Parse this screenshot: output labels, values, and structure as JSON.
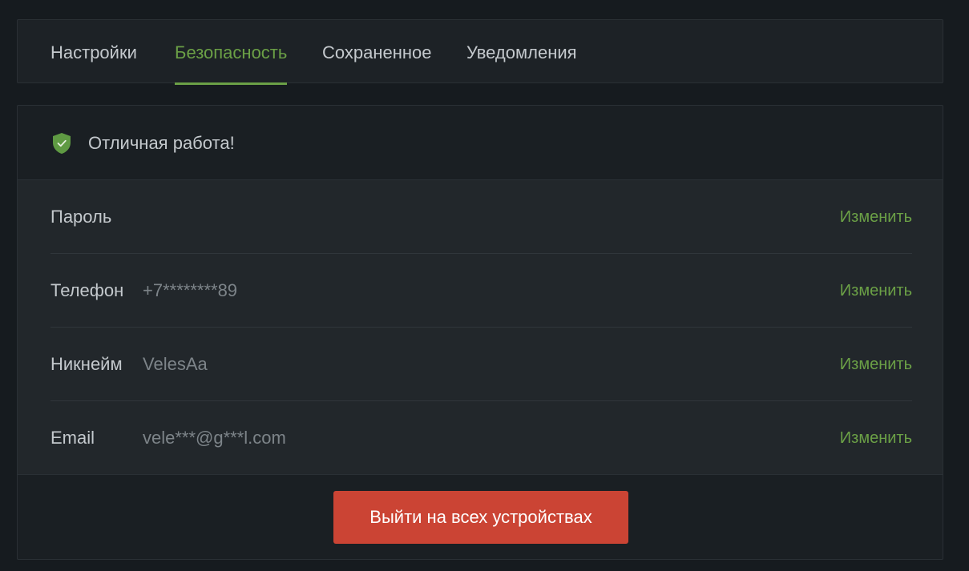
{
  "tabs": [
    {
      "label": "Настройки",
      "active": false
    },
    {
      "label": "Безопасность",
      "active": true
    },
    {
      "label": "Сохраненное",
      "active": false
    },
    {
      "label": "Уведомления",
      "active": false
    }
  ],
  "status": {
    "icon": "shield-check-icon",
    "text": "Отличная работа!"
  },
  "fields": [
    {
      "label": "Пароль",
      "value": "",
      "action": "Изменить"
    },
    {
      "label": "Телефон",
      "value": "+7********89",
      "action": "Изменить"
    },
    {
      "label": "Никнейм",
      "value": "VelesAa",
      "action": "Изменить"
    },
    {
      "label": "Email",
      "value": "vele***@g***l.com",
      "action": "Изменить"
    }
  ],
  "logout": {
    "label": "Выйти на всех устройствах"
  },
  "colors": {
    "background": "#161b1f",
    "panel": "#1d2226",
    "accent": "#6ba046",
    "danger": "#cb4434"
  }
}
